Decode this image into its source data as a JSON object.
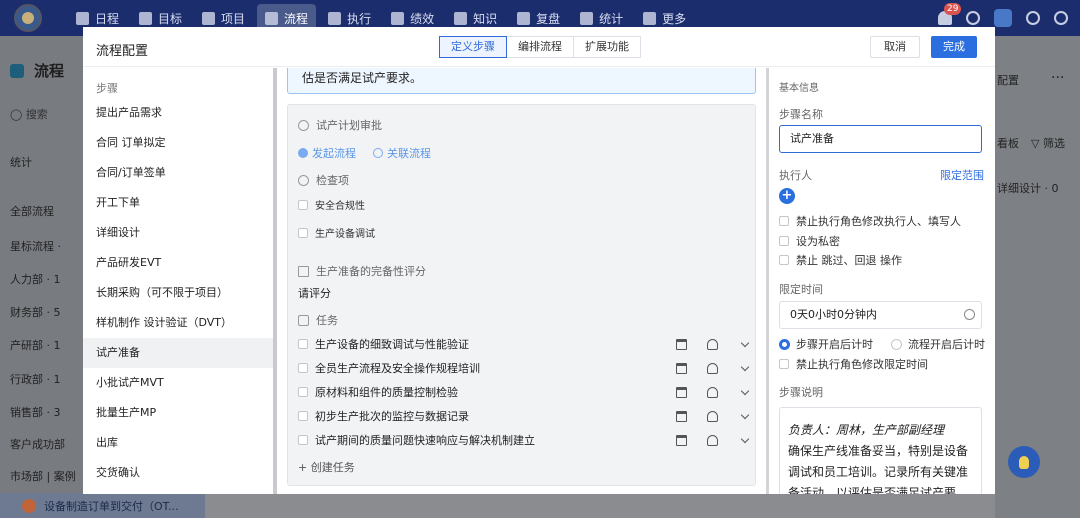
{
  "topbar": {
    "nav": [
      {
        "label": "日程",
        "icon": "calendar-icon"
      },
      {
        "label": "目标",
        "icon": "target-icon"
      },
      {
        "label": "项目",
        "icon": "cube-icon"
      },
      {
        "label": "流程",
        "icon": "flow-icon"
      },
      {
        "label": "执行",
        "icon": "list-icon"
      },
      {
        "label": "绩效",
        "icon": "chart-icon"
      },
      {
        "label": "知识",
        "icon": "book-icon"
      },
      {
        "label": "复盘",
        "icon": "review-icon"
      },
      {
        "label": "统计",
        "icon": "pie-icon"
      },
      {
        "label": "更多",
        "icon": "grid-icon"
      }
    ],
    "active_index": 3,
    "notifications_count": "29"
  },
  "background": {
    "page_title": "流程",
    "search_placeholder": "搜索",
    "left_items": [
      "统计",
      "全部流程",
      "星标流程 ·",
      "人力部 · 1",
      "财务部 · 5",
      "产研部 · 1",
      "行政部 · 1",
      "销售部 · 3",
      "客户成功部",
      "市场部 | 案例"
    ],
    "bottom_item": "设备制造订单到交付（OT...",
    "right_items": [
      "配置",
      "看板",
      "筛选",
      "详细设计 · 0"
    ]
  },
  "modal": {
    "title": "流程配置",
    "tabs": [
      "定义步骤",
      "编排流程",
      "扩展功能"
    ],
    "active_tab": 0,
    "cancel_label": "取消",
    "done_label": "完成",
    "steps_heading": "步骤",
    "steps": [
      "提出产品需求",
      "合同 订单拟定",
      "合同/订单签单",
      "开工下单",
      "详细设计",
      "产品研发EVT",
      "长期采购（可不限于项目）",
      "样机制作 设计验证（DVT）",
      "试产准备",
      "小批试产MVT",
      "批量生产MP",
      "出库",
      "交货确认"
    ],
    "active_step": 8,
    "middle": {
      "notice_text": "估是否满足试产要求。",
      "approval_section": "试产计划审批",
      "start_flow_link": "发起流程",
      "related_flow_link": "关联流程",
      "checks_section": "检查项",
      "checks": [
        "安全合规性",
        "生产设备调试"
      ],
      "rating_section": "生产准备的完备性评分",
      "rating_prompt": "请评分",
      "tasks_section": "任务",
      "tasks": [
        "生产设备的细致调试与性能验证",
        "全员生产流程及安全操作规程培训",
        "原材料和组件的质量控制检验",
        "初步生产批次的监控与数据记录",
        "试产期间的质量问题快速响应与解决机制建立"
      ],
      "create_task": "+ 创建任务"
    },
    "right": {
      "basic_info": "基本信息",
      "step_name_label": "步骤名称",
      "step_name_value": "试产准备",
      "executor_label": "执行人",
      "limit_scope_link": "限定范围",
      "add_symbol": "+",
      "options": [
        "禁止执行角色修改执行人、填写人",
        "设为私密",
        "禁止 跳过、回退 操作"
      ],
      "time_label": "限定时间",
      "time_value": "0天0小时0分钟内",
      "timing_radios": [
        "步骤开启后计时",
        "流程开启后计时"
      ],
      "selected_radio": 0,
      "time_option": "禁止执行角色修改限定时间",
      "desc_label": "步骤说明",
      "desc_lead": "负责人：周林，生产部副经理",
      "desc_body": "确保生产线准备妥当，特别是设备调试和员工培训。记录所有关键准备活动，以评估是否满足试产要"
    }
  }
}
